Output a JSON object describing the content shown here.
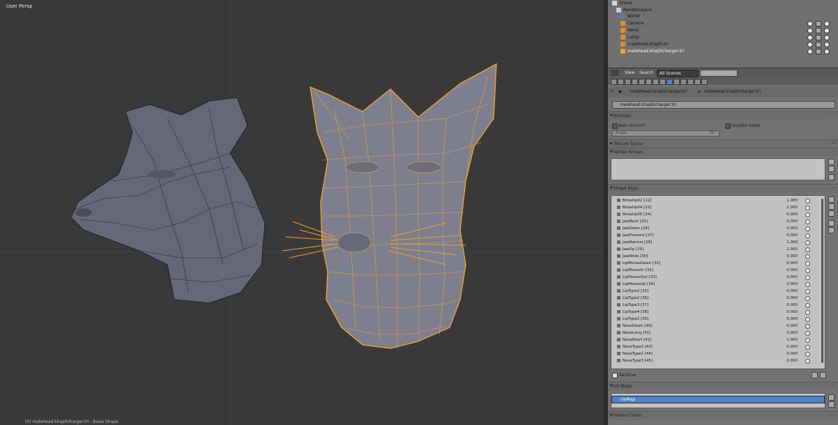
{
  "viewport": {
    "view_label": "User Persp",
    "status": "(0) malehead.khajiitcharger.tri : Basis Shape"
  },
  "outliner": {
    "rows": [
      {
        "label": "Scene"
      },
      {
        "label": "RenderLayers"
      },
      {
        "label": "World"
      },
      {
        "label": "Camera"
      },
      {
        "label": "Hemi"
      },
      {
        "label": "Lamp"
      },
      {
        "label": "malehead.khajiit.tri"
      },
      {
        "label": "malehead.khajiitcharger.tri"
      }
    ],
    "view_menu": "View",
    "search_menu": "Search",
    "scene_filter": "All Scenes"
  },
  "properties": {
    "breadcrumb": [
      "malehead.khajiitcharger.tri",
      "malehead.khajiitcharger.tri"
    ],
    "mesh_name": "malehead.khajiitcharger.tri",
    "normals": {
      "title": "Normals",
      "auto_smooth": "Auto Smooth",
      "double_sided": "Double Sided",
      "angle_label": "Angle:",
      "angle_value": "30°"
    },
    "texture_space": "Texture Space",
    "vertex_groups": "Vertex Groups",
    "shape_keys": {
      "title": "Shape Keys",
      "rows": [
        {
          "name": "BrowUp02",
          "index": "22",
          "value": "1.000"
        },
        {
          "name": "BrowUp04",
          "index": "23",
          "value": "1.000"
        },
        {
          "name": "BrowUp05",
          "index": "24",
          "value": "0.000"
        },
        {
          "name": "JawBack",
          "index": "25",
          "value": "0.000"
        },
        {
          "name": "JawDown",
          "index": "26",
          "value": "0.000"
        },
        {
          "name": "JawForward",
          "index": "27",
          "value": "0.000"
        },
        {
          "name": "JawNarrow",
          "index": "28",
          "value": "1.000"
        },
        {
          "name": "JawUp",
          "index": "29",
          "value": "1.000"
        },
        {
          "name": "JawWide",
          "index": "30",
          "value": "0.000"
        },
        {
          "name": "LipMovesDown",
          "index": "31",
          "value": "0.000"
        },
        {
          "name": "LipMovesIn",
          "index": "32",
          "value": "0.000"
        },
        {
          "name": "LipMovesOut",
          "index": "33",
          "value": "0.000"
        },
        {
          "name": "LipMovesUp",
          "index": "34",
          "value": "0.000"
        },
        {
          "name": "LipType2",
          "index": "35",
          "value": "0.000"
        },
        {
          "name": "LipType2",
          "index": "36",
          "value": "0.000"
        },
        {
          "name": "LipType3",
          "index": "37",
          "value": "0.000"
        },
        {
          "name": "LipType4",
          "index": "38",
          "value": "0.000"
        },
        {
          "name": "LipType2",
          "index": "39",
          "value": "0.000"
        },
        {
          "name": "NoseDown",
          "index": "40",
          "value": "0.000"
        },
        {
          "name": "NoseLong",
          "index": "41",
          "value": "0.000"
        },
        {
          "name": "NoseShort",
          "index": "42",
          "value": "1.000"
        },
        {
          "name": "NoseType2",
          "index": "43",
          "value": "0.000"
        },
        {
          "name": "NoseType2",
          "index": "44",
          "value": "0.000"
        },
        {
          "name": "NoseType3",
          "index": "45",
          "value": "0.000"
        }
      ]
    },
    "relative": "Relative",
    "uv_maps": {
      "title": "UV Maps",
      "items": [
        "UVMap"
      ]
    },
    "vertex_colors": "Vertex Colors"
  },
  "colors": {
    "selection_orange": "#f0a030",
    "uv_highlight": "#5180c4",
    "mesh_grey": "#6e7282"
  }
}
